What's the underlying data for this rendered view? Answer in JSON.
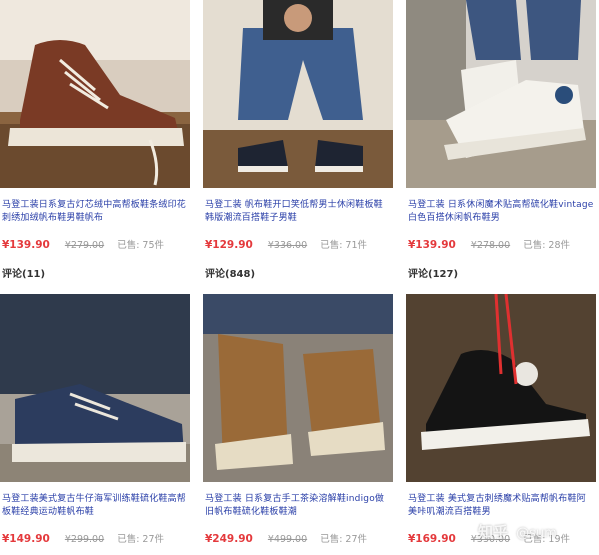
{
  "products": [
    {
      "title": "马登工装日系复古灯芯绒中高帮板鞋条绒印花刺绣加绒帆布鞋男鞋帆布",
      "price": "¥139.90",
      "original_price": "¥279.00",
      "sold": "已售: 75件",
      "reviews": "评论(11)"
    },
    {
      "title": "马登工装 帆布鞋开口笑低帮男士休闲鞋板鞋韩版潮流百搭鞋子男鞋",
      "price": "¥129.90",
      "original_price": "¥336.00",
      "sold": "已售: 71件",
      "reviews": "评论(848)"
    },
    {
      "title": "马登工装 日系休闲魔术贴高帮硫化鞋vintage白色百搭休闲帆布鞋男",
      "price": "¥139.90",
      "original_price": "¥278.00",
      "sold": "已售: 28件",
      "reviews": "评论(127)"
    },
    {
      "title": "马登工装美式复古牛仔海军训练鞋硫化鞋高帮板鞋经典运动鞋帆布鞋",
      "price": "¥149.90",
      "original_price": "¥299.00",
      "sold": "已售: 27件",
      "reviews": ""
    },
    {
      "title": "马登工装 日系复古手工茶染溶解鞋indigo做旧帆布鞋硫化鞋板鞋潮",
      "price": "¥249.90",
      "original_price": "¥499.00",
      "sold": "已售: 27件",
      "reviews": ""
    },
    {
      "title": "马登工装 美式复古刺绣魔术贴高帮帆布鞋阿美咔叽潮流百搭鞋男",
      "price": "¥169.90",
      "original_price": "¥330.00",
      "sold": "已售: 19件",
      "reviews": ""
    }
  ],
  "watermark": {
    "brand": "知乎",
    "handle": "@sum"
  }
}
